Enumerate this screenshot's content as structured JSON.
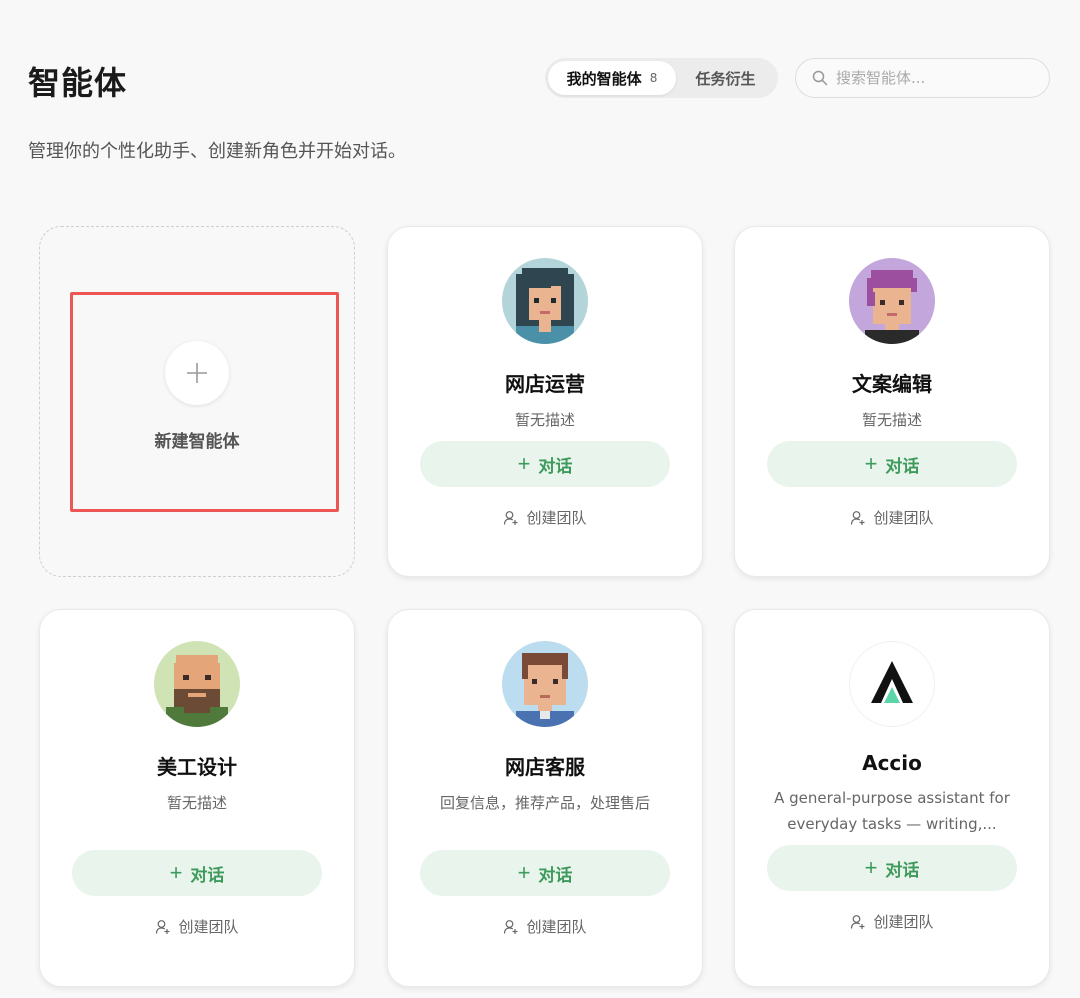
{
  "header": {
    "title": "智能体",
    "subtitle": "管理你的个性化助手、创建新角色并开始对话。",
    "tabs": [
      {
        "label": "我的智能体",
        "count": "8",
        "active": true
      },
      {
        "label": "任务衍生",
        "active": false
      }
    ],
    "search_placeholder": "搜索智能体..."
  },
  "new_agent": {
    "label": "新建智能体"
  },
  "agents": [
    {
      "name": "网店运营",
      "description": "暂无描述",
      "chat_label": "对话",
      "team_label": "创建团队",
      "avatar": "pixel-woman-dark-hair"
    },
    {
      "name": "文案编辑",
      "description": "暂无描述",
      "chat_label": "对话",
      "team_label": "创建团队",
      "avatar": "pixel-person-purple-hair"
    },
    {
      "name": "美工设计",
      "description": "暂无描述",
      "chat_label": "对话",
      "team_label": "创建团队",
      "avatar": "pixel-bearded-man"
    },
    {
      "name": "网店客服",
      "description": "回复信息，推荐产品，处理售后",
      "chat_label": "对话",
      "team_label": "创建团队",
      "avatar": "pixel-man-brown-hair"
    },
    {
      "name": "Accio",
      "description": "A general-purpose assistant for everyday tasks — writing,...",
      "chat_label": "对话",
      "team_label": "创建团队",
      "avatar": "accio-logo"
    }
  ],
  "colors": {
    "accent_green": "#3d9a5b",
    "button_bg": "#e9f5ec",
    "highlight_red": "#ee5555"
  }
}
